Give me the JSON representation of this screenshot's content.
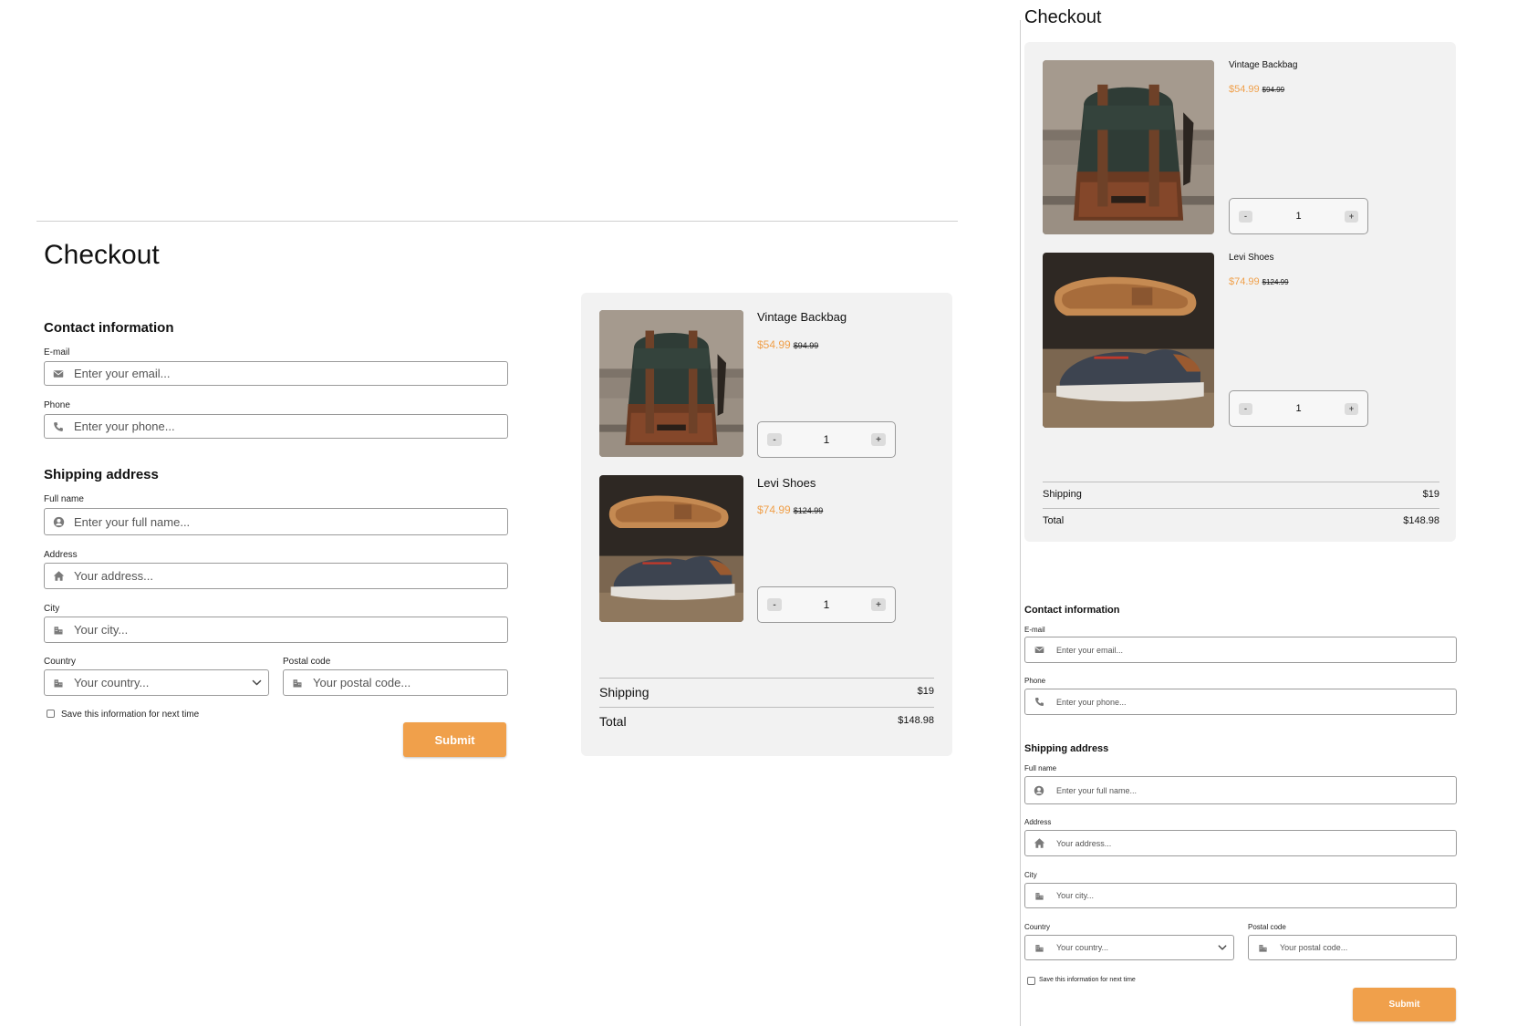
{
  "page_title": "Checkout",
  "contact": {
    "heading": "Contact information",
    "email_label": "E-mail",
    "email_placeholder": "Enter your email...",
    "phone_label": "Phone",
    "phone_placeholder": "Enter your phone..."
  },
  "shipping_address": {
    "heading": "Shipping address",
    "fullname_label": "Full name",
    "fullname_placeholder": "Enter your full name...",
    "address_label": "Address",
    "address_placeholder": "Your address...",
    "city_label": "City",
    "city_placeholder": "Your city...",
    "country_label": "Country",
    "country_placeholder": "Your country...",
    "postal_label": "Postal code",
    "postal_placeholder": "Your postal code..."
  },
  "save_info_label": "Save this information for next time",
  "submit_label": "Submit",
  "cart": {
    "items": [
      {
        "name": "Vintage Backbag",
        "price": "$54.99",
        "old_price": "$94.99",
        "quantity": "1"
      },
      {
        "name": "Levi Shoes",
        "price": "$74.99",
        "old_price": "$124.99",
        "quantity": "1"
      }
    ],
    "stepper_minus": "-",
    "stepper_plus": "+",
    "shipping_label": "Shipping",
    "shipping_value": "$19",
    "total_label": "Total",
    "total_value": "$148.98"
  },
  "colors": {
    "accent": "#f0a04b",
    "cart_background": "#f2f2f2"
  },
  "icons": {
    "email": "envelope-icon",
    "phone": "phone-icon",
    "fullname": "user-circle-icon",
    "address": "home-icon",
    "city": "building-icon",
    "country": "building-icon",
    "postal": "building-icon",
    "dropdown": "chevron-down-icon"
  }
}
